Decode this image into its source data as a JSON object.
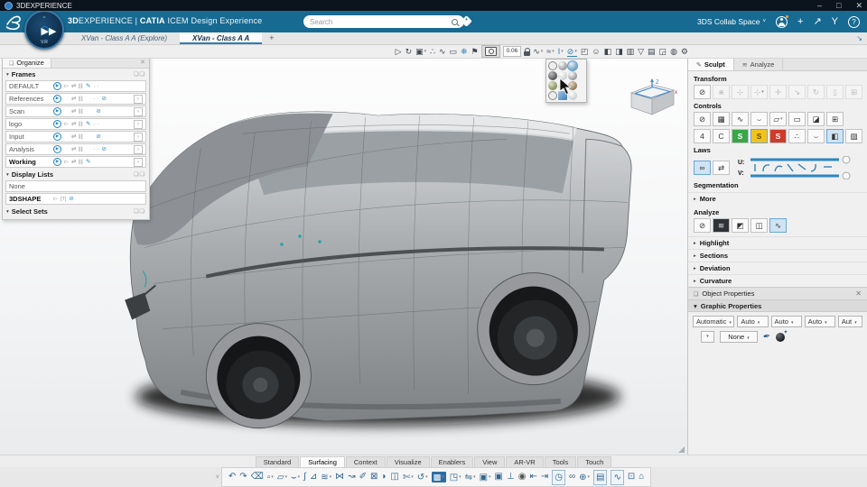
{
  "titlebar": {
    "title": "3DEXPERIENCE",
    "minimize": "–",
    "maximize": "□",
    "close": "✕"
  },
  "appbar": {
    "brand_bold": "3D",
    "brand_light": "EXPERIENCE",
    "separator": "|",
    "brand2_bold": "CATIA",
    "brand3": "ICEM Design Experience",
    "search_placeholder": "Search",
    "collab_label": "3DS Collab Space",
    "collab_caret": "˅",
    "add_label": "+",
    "share_label": "↗",
    "swym_label": "Y",
    "help_label": "?",
    "compass_version": "V.R",
    "compass_play": "▶",
    "compass_tick": "ʷ"
  },
  "doc_tabs": {
    "items": [
      {
        "label": "XVan - Class A A (Explore)",
        "name": "tab-xvan-explore"
      },
      {
        "label": "XVan - Class A A",
        "cls": "active",
        "name": "tab-xvan-class-a"
      }
    ],
    "add": "+",
    "expand": "↘"
  },
  "top_toolbar": {
    "tolerance": "0.06",
    "icons_left": [
      {
        "name": "select-tool-icon",
        "glyph": "▷"
      },
      {
        "name": "orbit-tool-icon",
        "glyph": "↻"
      },
      {
        "name": "selection-set-icon",
        "glyph": "▣",
        "cls": "dd"
      },
      {
        "name": "point-snap-icon",
        "glyph": "∴"
      },
      {
        "name": "curve-snap-icon",
        "glyph": "∿"
      },
      {
        "name": "trap-select-icon",
        "glyph": "▭"
      },
      {
        "name": "snap-grid-icon",
        "glyph": "❄",
        "cls": "blue"
      },
      {
        "name": "pick-filter-icon",
        "glyph": "⚑"
      }
    ],
    "icons_right": [
      {
        "name": "spline-tool-icon",
        "glyph": "∿",
        "cls": "dd"
      },
      {
        "name": "refit-tool-icon",
        "glyph": "≈",
        "cls": "dd"
      },
      {
        "name": "mannequin-icon",
        "glyph": "I",
        "cls": "blue dd"
      },
      {
        "name": "render-style-icon",
        "glyph": "⊘",
        "cls": "active dd"
      },
      {
        "name": "fullscreen-icon",
        "glyph": "◰"
      },
      {
        "name": "ambience-icon",
        "glyph": "☺"
      },
      {
        "name": "ground-icon",
        "glyph": "◧"
      },
      {
        "name": "frame-display-icon",
        "glyph": "◨"
      },
      {
        "name": "multiview-icon",
        "glyph": "▥"
      },
      {
        "name": "filter-icon",
        "glyph": "▽"
      },
      {
        "name": "layers-icon",
        "glyph": "▤"
      },
      {
        "name": "clipping-icon",
        "glyph": "◲"
      },
      {
        "name": "magnet-icon",
        "glyph": "◍"
      },
      {
        "name": "settings-gear-icon",
        "glyph": "⚙"
      }
    ]
  },
  "left_panel": {
    "tab": "Organize",
    "frames": {
      "title": "Frames",
      "rows": [
        {
          "label": "DEFAULT",
          "play": true,
          "cursor": true,
          "links": true,
          "cols": true,
          "pencil": true,
          "dots": "· ·",
          "eye": false,
          "endbox": false
        },
        {
          "label": "References",
          "play": true,
          "cursor": false,
          "links": true,
          "cols": true,
          "pencil": false,
          "dots": "· ·",
          "eye": true,
          "endbox": true
        },
        {
          "label": "Scan",
          "play": true,
          "cursor": false,
          "links": true,
          "cols": true,
          "pencil": false,
          "dots": "",
          "eye": true,
          "endbox": true
        },
        {
          "label": "logo",
          "play": true,
          "cursor": true,
          "links": true,
          "cols": true,
          "pencil": true,
          "dots": "· ·",
          "eye": false,
          "endbox": true
        },
        {
          "label": "Input",
          "play": true,
          "cursor": false,
          "links": true,
          "cols": true,
          "pencil": false,
          "dots": "",
          "eye": true,
          "endbox": true
        },
        {
          "label": "Analysis",
          "play": true,
          "cursor": false,
          "links": true,
          "cols": true,
          "pencil": false,
          "dots": "· ·",
          "eye": true,
          "endbox": true
        },
        {
          "label": "Working",
          "cls": "bold",
          "play": true,
          "cursor": true,
          "links": true,
          "cols": true,
          "pencil": true,
          "dots": "",
          "eye": false,
          "endbox": true
        }
      ]
    },
    "display_lists": {
      "title": "Display Lists",
      "rows": [
        {
          "label": "None"
        },
        {
          "label": "3DSHAPE",
          "cls": "bold",
          "cursor": true,
          "tbox": "[T]",
          "eye": true
        }
      ]
    },
    "select_sets": {
      "title": "Select Sets"
    }
  },
  "right_panel": {
    "tabs": [
      {
        "label": "Sculpt",
        "cls": "active",
        "name": "tab-sculpt"
      },
      {
        "label": "Analyze",
        "name": "tab-analyze"
      }
    ],
    "transform": {
      "title": "Transform",
      "buttons": [
        {
          "name": "no-transform-icon",
          "glyph": "⊘"
        },
        {
          "name": "translate-icon",
          "glyph": "⋇",
          "cls": "dis"
        },
        {
          "name": "axis-move-icon",
          "glyph": "⊹",
          "cls": "dis"
        },
        {
          "name": "axis-rotate-icon",
          "glyph": "⊹",
          "cls": "dis dd"
        },
        {
          "name": "free-drag-icon",
          "glyph": "✛",
          "cls": "dis"
        },
        {
          "name": "scale-icon",
          "glyph": "↘",
          "cls": "dis"
        },
        {
          "name": "rotate-icon",
          "glyph": "↻",
          "cls": "dis"
        },
        {
          "name": "mirror-icon",
          "glyph": "▯",
          "cls": "dis"
        },
        {
          "name": "handles-icon",
          "glyph": "⊞",
          "cls": "dis"
        }
      ]
    },
    "controls": {
      "title": "Controls",
      "row1": [
        {
          "name": "no-control-icon",
          "glyph": "⊘"
        },
        {
          "name": "control-cage-icon",
          "glyph": "▦"
        },
        {
          "name": "curve-points-icon",
          "glyph": "∿"
        },
        {
          "name": "curve-handle-icon",
          "glyph": "⌣"
        },
        {
          "name": "surface-cage-icon",
          "glyph": "▱",
          "cls": "dd"
        },
        {
          "name": "patch-edit-icon",
          "glyph": "▭"
        },
        {
          "name": "sheet-edit-icon",
          "glyph": "◪"
        },
        {
          "name": "window-edit-icon",
          "glyph": "⊞"
        }
      ],
      "row2": [
        {
          "name": "order-4-icon",
          "glyph": "4"
        },
        {
          "name": "order-c-icon",
          "glyph": "C"
        },
        {
          "name": "green-state-icon",
          "glyph": "S",
          "cls": "green"
        },
        {
          "name": "yellow-state-icon",
          "glyph": "S",
          "cls": "yellow sel"
        },
        {
          "name": "red-state-icon",
          "glyph": "S",
          "cls": "red"
        },
        {
          "name": "point-weight-icon",
          "glyph": "∴"
        },
        {
          "name": "tangent-icon",
          "glyph": "⌣"
        },
        {
          "name": "blue-surface-icon",
          "glyph": "◧",
          "cls": "sel"
        },
        {
          "name": "hatch-icon",
          "glyph": "▨"
        }
      ]
    },
    "laws": {
      "title": "Laws",
      "buttons": [
        {
          "name": "law-link-icon",
          "glyph": "∞",
          "cls": "sel"
        },
        {
          "name": "law-slider-icon",
          "glyph": "⇄"
        }
      ],
      "u_label": "U:",
      "v_label": "V:"
    },
    "segmentation_title": "Segmentation",
    "more_label": "More",
    "analyze": {
      "title": "Analyze",
      "buttons": [
        {
          "name": "no-analysis-icon",
          "glyph": "⊘"
        },
        {
          "name": "zebra-stripes-icon",
          "glyph": "≋",
          "cls": "darkicon"
        },
        {
          "name": "surface-check-icon",
          "glyph": "◩"
        },
        {
          "name": "mesh-check-icon",
          "glyph": "◫"
        },
        {
          "name": "curvature-graph-icon",
          "glyph": "∿",
          "cls": "sel"
        }
      ]
    },
    "collapsed": [
      {
        "label": "Highlight",
        "name": "section-highlight"
      },
      {
        "label": "Sections",
        "name": "section-sections"
      },
      {
        "label": "Deviation",
        "name": "section-deviation"
      },
      {
        "label": "Curvature",
        "name": "section-curvature"
      }
    ],
    "object_properties_title": "Object Properties",
    "graphic_properties": {
      "title": "Graphic Properties",
      "dropdowns": [
        "Automatic",
        "Auto",
        "Auto",
        "Auto",
        "Aut"
      ],
      "none_value": "None"
    }
  },
  "viewport": {
    "compass": {
      "z": "Z",
      "x": "x"
    },
    "palette": [
      {
        "name": "style-wireframe-icon",
        "cls": "wire"
      },
      {
        "name": "style-shaded-icon",
        "cls": ""
      },
      {
        "name": "style-shaded-edges-icon",
        "cls": "selstyle"
      },
      {
        "name": "style-dark-icon",
        "cls": "darksw"
      },
      {
        "name": "style-flat-icon",
        "cls": "light"
      },
      {
        "name": "style-gray-icon",
        "cls": ""
      },
      {
        "name": "style-olive-icon",
        "cls": "olive"
      },
      {
        "name": "style-white-icon",
        "cls": "light"
      },
      {
        "name": "style-tan-icon",
        "cls": "tan"
      },
      {
        "name": "style-wire2-icon",
        "cls": "wire"
      },
      {
        "name": "style-cube-icon",
        "cls": "cubesw"
      },
      {
        "name": "style-ghost-icon",
        "cls": "light"
      }
    ]
  },
  "bottom_tabs": {
    "items": [
      {
        "label": "Standard",
        "name": "ribbon-tab-standard"
      },
      {
        "label": "Surfacing",
        "cls": "active",
        "name": "ribbon-tab-surfacing"
      },
      {
        "label": "Context",
        "name": "ribbon-tab-context"
      },
      {
        "label": "Visualize",
        "name": "ribbon-tab-visualize"
      },
      {
        "label": "Enablers",
        "name": "ribbon-tab-enablers"
      },
      {
        "label": "View",
        "name": "ribbon-tab-view"
      },
      {
        "label": "AR-VR",
        "name": "ribbon-tab-ar-vr"
      },
      {
        "label": "Tools",
        "name": "ribbon-tab-tools"
      },
      {
        "label": "Touch",
        "name": "ribbon-tab-touch"
      }
    ]
  },
  "bottom_toolbar": {
    "collapse": "˅",
    "icons": [
      {
        "name": "undo-icon",
        "glyph": "↶"
      },
      {
        "name": "redo-icon",
        "glyph": "↷"
      },
      {
        "name": "delete-icon",
        "glyph": "⌫"
      },
      {
        "name": "point-icon",
        "glyph": "▫",
        "cls": "dd gray"
      },
      {
        "name": "plane-icon",
        "glyph": "▱",
        "cls": "dd"
      },
      {
        "name": "curve-create-icon",
        "glyph": "⌣",
        "cls": "dd"
      },
      {
        "name": "spline-icon",
        "glyph": "∫"
      },
      {
        "name": "corner-surface-icon",
        "glyph": "⊿"
      },
      {
        "name": "blend-surface-icon",
        "glyph": "≋",
        "cls": "dd"
      },
      {
        "name": "match-surface-icon",
        "glyph": "⋈"
      },
      {
        "name": "curve-edit-icon",
        "glyph": "↝"
      },
      {
        "name": "freeform-icon",
        "glyph": "✐"
      },
      {
        "name": "control-frame-icon",
        "glyph": "⊠"
      },
      {
        "name": "bend-surface-icon",
        "glyph": "◗"
      },
      {
        "name": "half-space-icon",
        "glyph": "◫"
      },
      {
        "name": "knife-icon",
        "glyph": "✄",
        "cls": "dd"
      },
      {
        "name": "twist-icon",
        "glyph": "↺",
        "cls": "dd"
      },
      {
        "name": "subdivision-icon",
        "glyph": "▩",
        "cls": "dark dd"
      },
      {
        "name": "cube-view-icon",
        "glyph": "◳",
        "cls": "dd"
      },
      {
        "name": "flip-surface-icon",
        "glyph": "⇋",
        "cls": "dd"
      },
      {
        "name": "image-plane-icon",
        "glyph": "▣",
        "cls": "dd"
      },
      {
        "name": "panel-icon",
        "glyph": "▣"
      },
      {
        "name": "measure-align-icon",
        "glyph": "⊥"
      },
      {
        "name": "snapshot-camera-icon",
        "glyph": "◉",
        "cls": "gray"
      },
      {
        "name": "first-frame-icon",
        "glyph": "⇤"
      },
      {
        "name": "last-frame-icon",
        "glyph": "⇥"
      },
      {
        "name": "timer-icon",
        "glyph": "◷",
        "cls": "boxed"
      },
      {
        "name": "link-pair-icon",
        "glyph": "∞"
      },
      {
        "name": "globe-icon",
        "glyph": "⊕",
        "cls": "dd"
      },
      {
        "name": "archive-icon",
        "glyph": "▤",
        "cls": "boxed"
      },
      {
        "name": "analyze-curve-icon",
        "glyph": "∿",
        "cls": "boxed"
      },
      {
        "name": "feedback-icon",
        "glyph": "⊡"
      },
      {
        "name": "home-icon",
        "glyph": "⌂"
      }
    ]
  }
}
